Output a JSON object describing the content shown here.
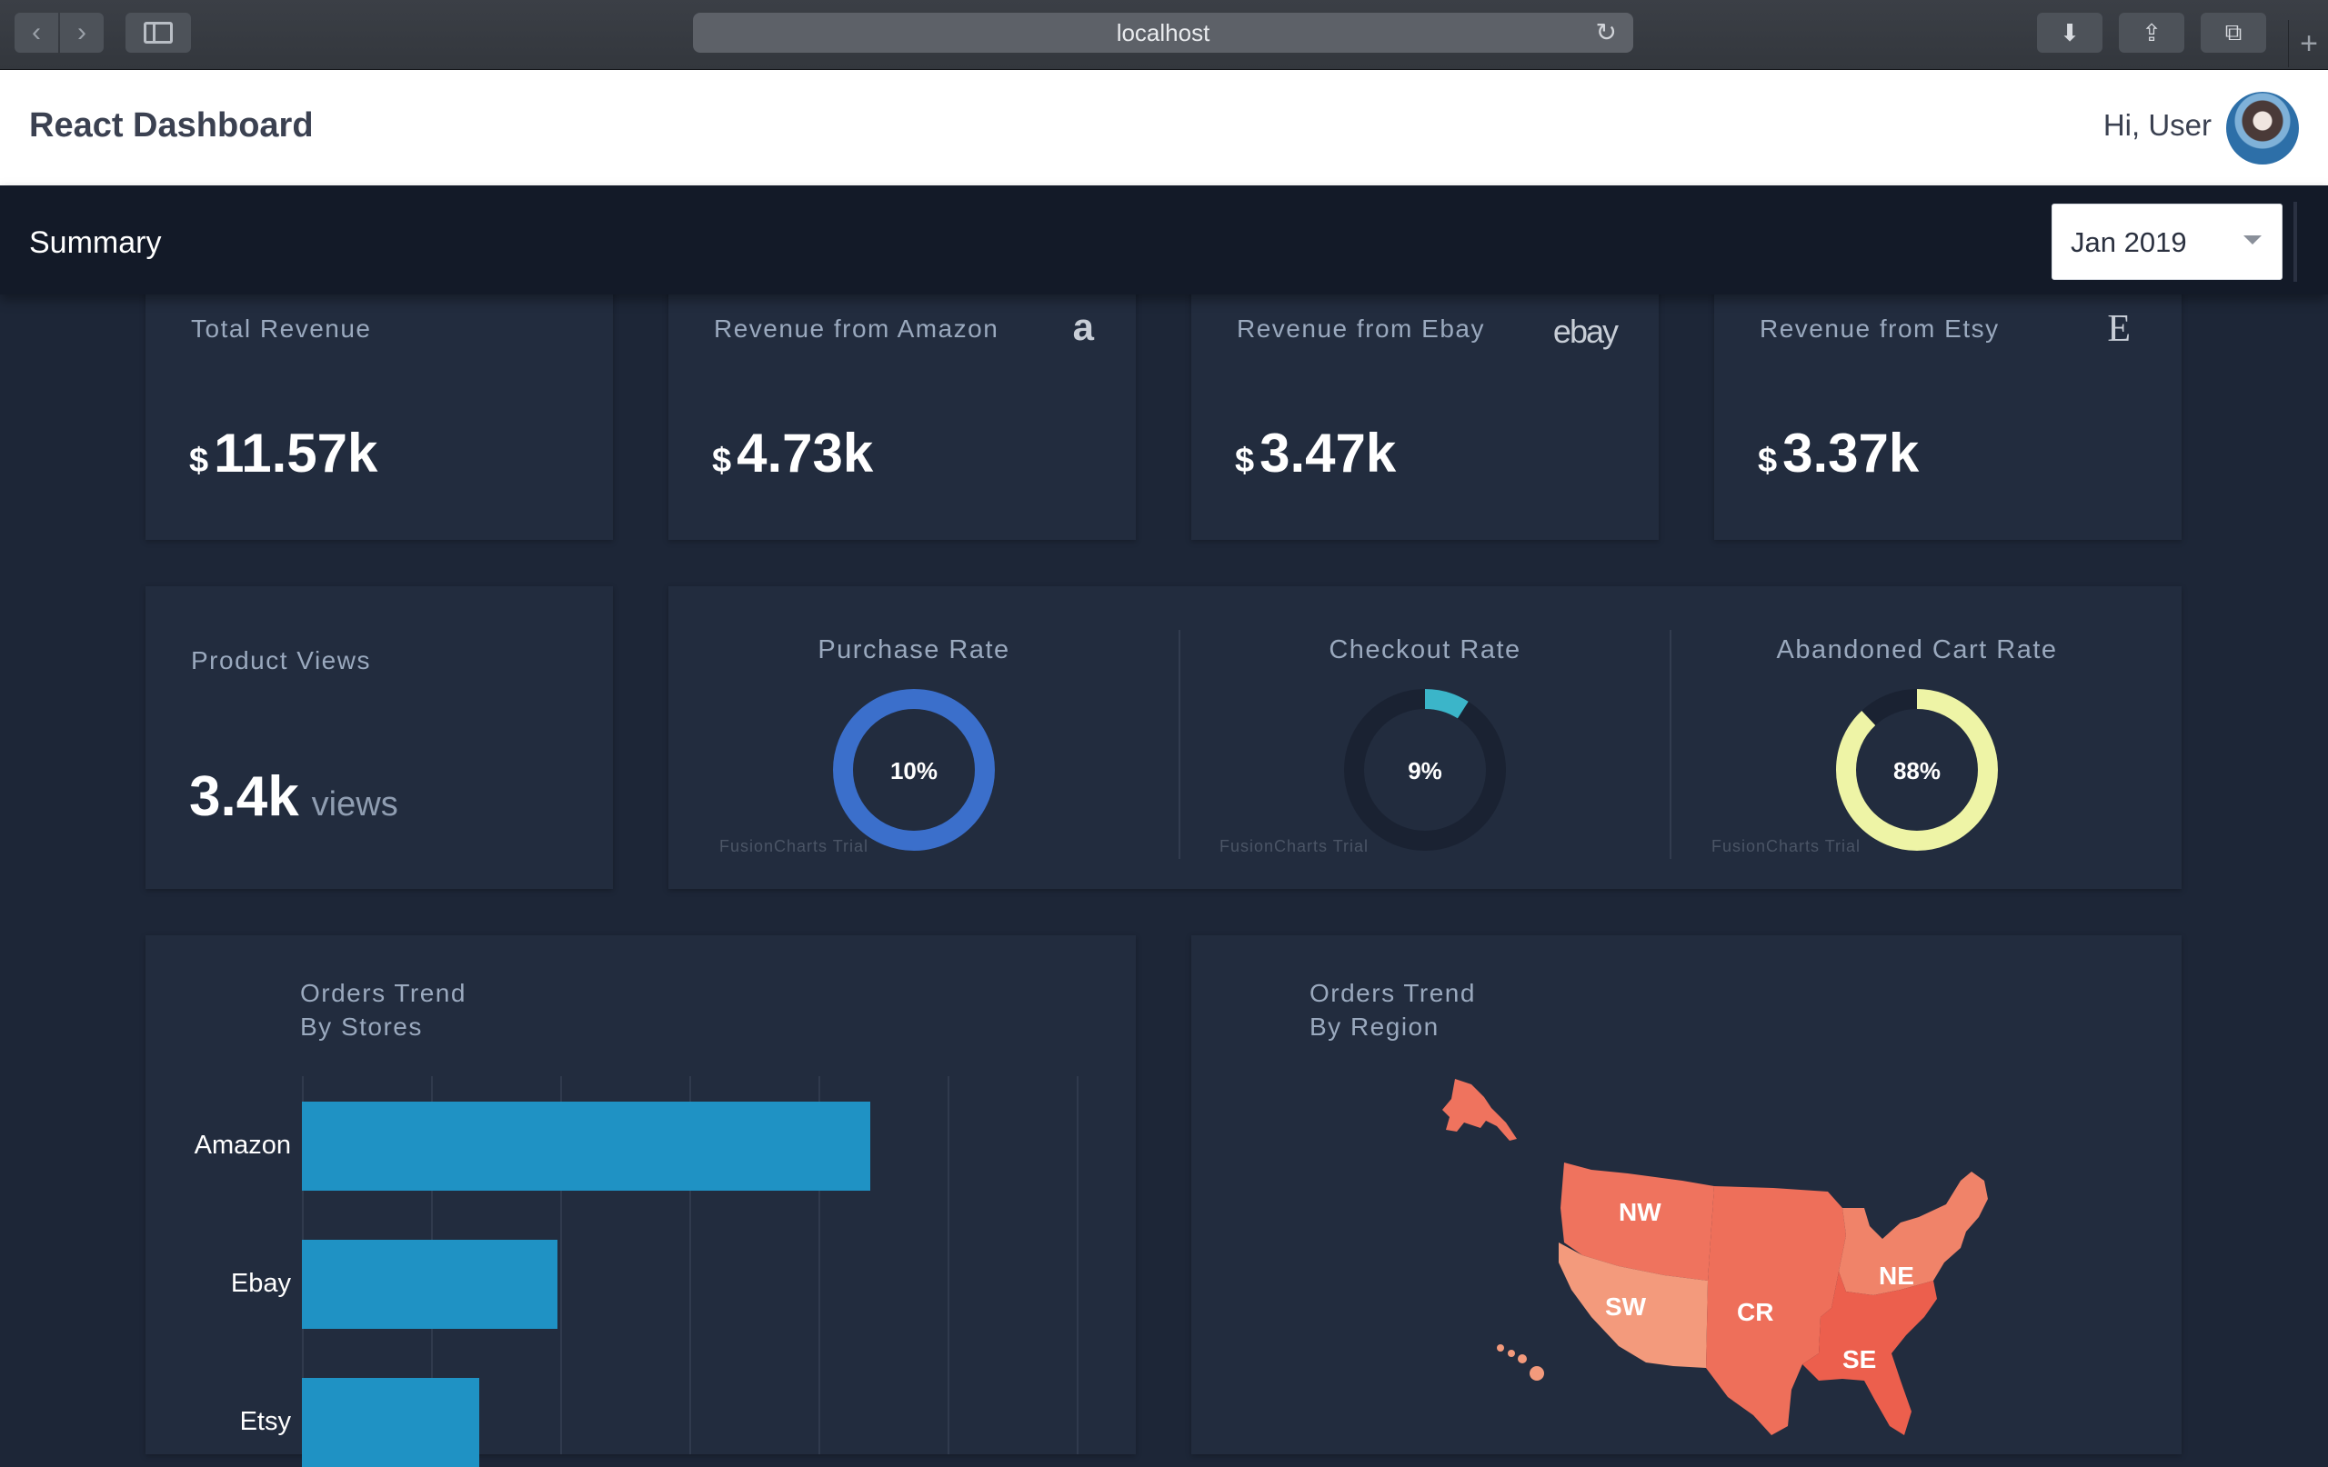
{
  "browser": {
    "address": "localhost",
    "back_icon": "‹",
    "forward_icon": "›",
    "reload_icon": "↻",
    "download_icon": "⬇",
    "share_icon": "⇪",
    "tabs_icon": "⧉",
    "new_tab_icon": "+"
  },
  "header": {
    "title": "React Dashboard",
    "greeting": "Hi, User"
  },
  "summary": {
    "title": "Summary",
    "date_selected": "Jan 2019"
  },
  "kpis": [
    {
      "label": "Total Revenue",
      "currency": "$",
      "value": "11.57k",
      "icon": ""
    },
    {
      "label": "Revenue from Amazon",
      "currency": "$",
      "value": "4.73k",
      "icon": "a"
    },
    {
      "label": "Revenue from Ebay",
      "currency": "$",
      "value": "3.47k",
      "icon": "ebay"
    },
    {
      "label": "Revenue from Etsy",
      "currency": "$",
      "value": "3.37k",
      "icon": "E"
    }
  ],
  "product_views": {
    "label": "Product Views",
    "value": "3.4k",
    "unit": "views"
  },
  "gauges": [
    {
      "title": "Purchase Rate",
      "display": "10%",
      "percent": 100,
      "color": "#3b6fcb",
      "trial": "FusionCharts Trial"
    },
    {
      "title": "Checkout Rate",
      "display": "9%",
      "percent": 9,
      "color": "#3bb5c9",
      "trial": "FusionCharts Trial"
    },
    {
      "title": "Abandoned Cart Rate",
      "display": "88%",
      "percent": 88,
      "color": "#eef4a6",
      "trial": "FusionCharts Trial"
    }
  ],
  "orders_by_store": {
    "title_line1": "Orders Trend",
    "title_line2": "By Stores",
    "chart_data": {
      "type": "bar",
      "orientation": "horizontal",
      "categories": [
        "Amazon",
        "Ebay",
        "Etsy"
      ],
      "values": [
        4.4,
        1.98,
        1.37
      ],
      "xlim": [
        0,
        6
      ],
      "grid": true,
      "color": "#1f92c4"
    }
  },
  "orders_by_region": {
    "title_line1": "Orders Trend",
    "title_line2": "By Region",
    "regions": [
      {
        "code": "NW",
        "color": "#ef735e"
      },
      {
        "code": "SW",
        "color": "#f39a7c"
      },
      {
        "code": "CR",
        "color": "#ee6f5a"
      },
      {
        "code": "NE",
        "color": "#f08369"
      },
      {
        "code": "SE",
        "color": "#ec5f4d"
      }
    ]
  }
}
